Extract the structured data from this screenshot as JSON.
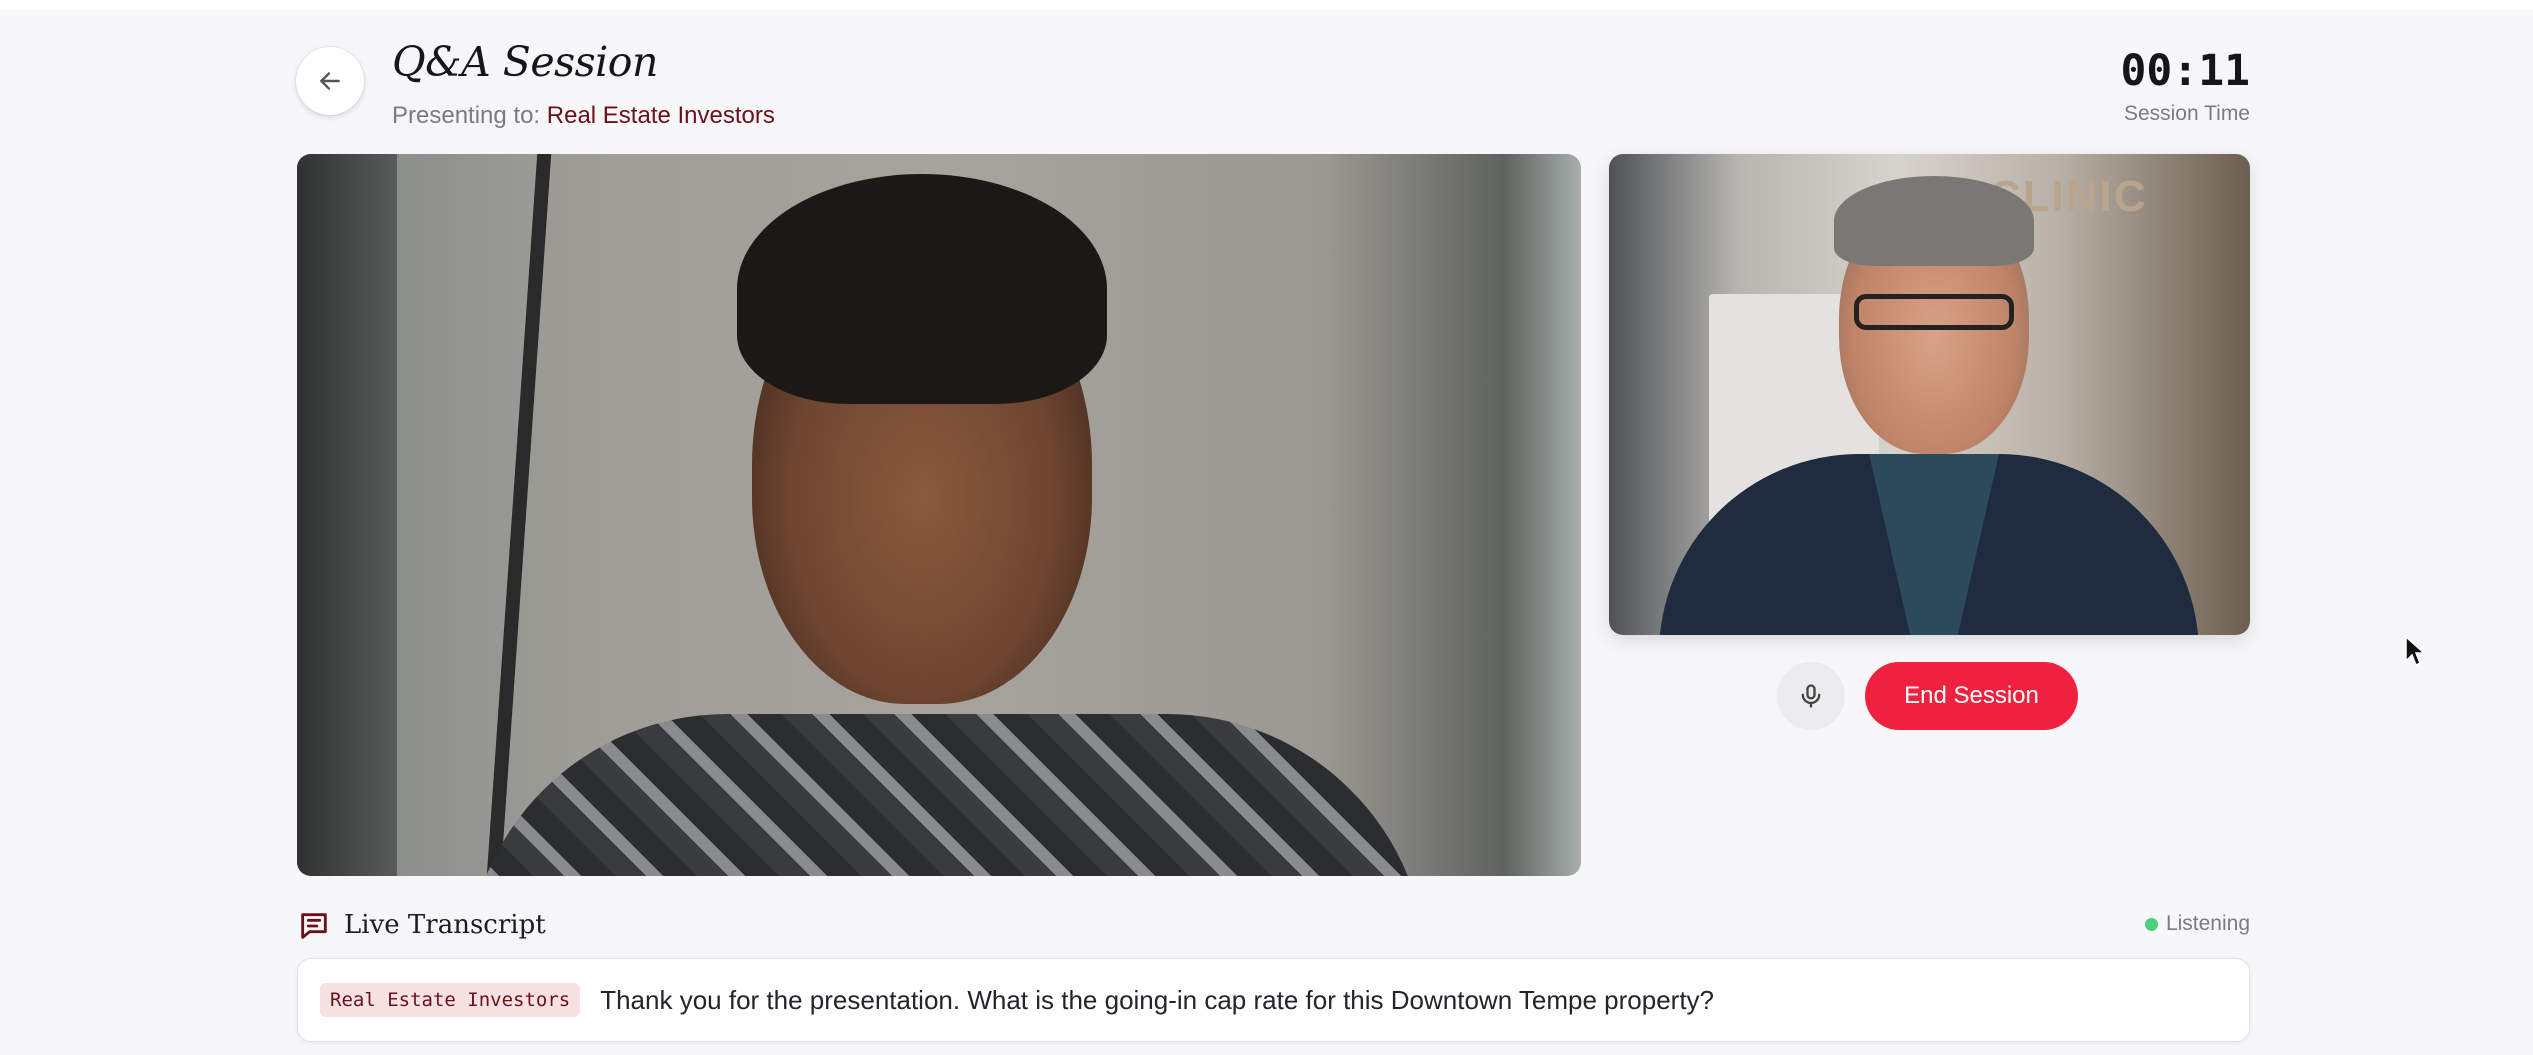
{
  "header": {
    "title": "Q&A Session",
    "presenting_label": "Presenting to:",
    "audience": "Real Estate Investors",
    "timer": "00:11",
    "timer_label": "Session Time"
  },
  "video": {
    "side_sign": "CLINIC"
  },
  "controls": {
    "end_session_label": "End Session"
  },
  "transcript": {
    "title": "Live Transcript",
    "status": "Listening",
    "speaker": "Real Estate Investors",
    "text": "Thank you for the presentation. What is the going-in cap rate for this Downtown Tempe property?"
  },
  "icons": {
    "back": "arrow-left-icon",
    "mic": "microphone-icon",
    "transcript": "chat-lines-icon",
    "cursor": "mouse-pointer-icon"
  },
  "colors": {
    "accent": "#6b0f1a",
    "end_button": "#f0213f",
    "listening_dot": "#4cd07d",
    "speaker_tag_bg": "#f8e1e3"
  }
}
